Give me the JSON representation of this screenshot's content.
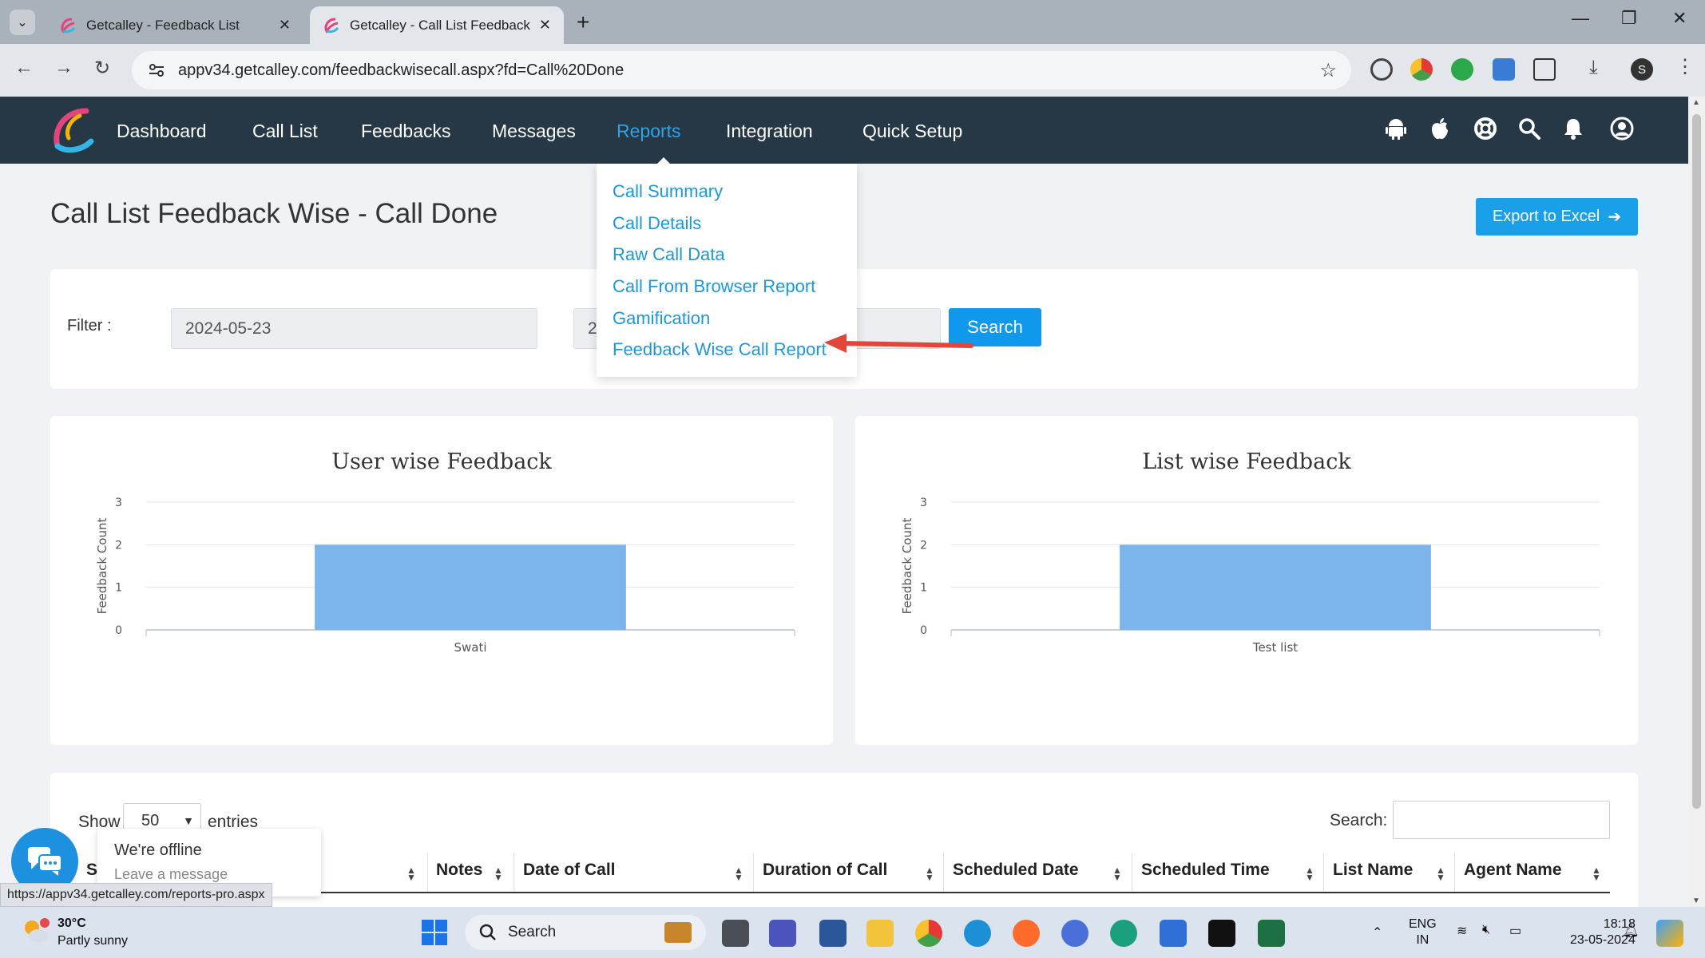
{
  "browser": {
    "tabs": [
      {
        "title": "Getcalley - Feedback List",
        "active": false
      },
      {
        "title": "Getcalley - Call List Feedback Wise",
        "active": true
      }
    ],
    "url": "appv34.getcalley.com/feedbackwisecall.aspx?fd=Call%20Done",
    "status_url": "https://appv34.getcalley.com/reports-pro.aspx"
  },
  "nav": {
    "items": [
      "Dashboard",
      "Call List",
      "Feedbacks",
      "Messages",
      "Reports",
      "Integration",
      "Quick Setup"
    ],
    "active": "Reports"
  },
  "reports_menu": {
    "items": [
      "Call Summary",
      "Call Details",
      "Raw Call Data",
      "Call From Browser Report",
      "Gamification",
      "Feedback Wise Call Report"
    ],
    "highlighted": "Feedback Wise Call Report"
  },
  "page": {
    "title": "Call List Feedback Wise - Call Done",
    "export_label": "Export to Excel",
    "filter_label": "Filter :",
    "from_date": "2024-05-23",
    "to_date_partial": "2",
    "search_label": "Search"
  },
  "chart_data": [
    {
      "type": "bar",
      "title": "User wise Feedback",
      "ylabel": "Feedback Count",
      "categories": [
        "Swati"
      ],
      "values": [
        2
      ],
      "ylim": [
        0,
        3
      ],
      "yticks": [
        "0",
        "1",
        "2",
        "3"
      ],
      "color": "#7cb5ec"
    },
    {
      "type": "bar",
      "title": "List wise Feedback",
      "ylabel": "Feedback Count",
      "categories": [
        "Test list"
      ],
      "values": [
        2
      ],
      "ylim": [
        0,
        3
      ],
      "yticks": [
        "0",
        "1",
        "2",
        "3"
      ],
      "color": "#7cb5ec"
    }
  ],
  "table": {
    "show_label": "Show",
    "entries_value": "50",
    "entries_label": "entries",
    "search_label": "Search:",
    "columns": [
      "S",
      "Notes",
      "Date of Call",
      "Duration of Call",
      "Scheduled Date",
      "Scheduled Time",
      "List Name",
      "Agent Name"
    ]
  },
  "chat": {
    "offline": "We're offline",
    "leave": "Leave a message"
  },
  "taskbar": {
    "temp": "30°C",
    "weather": "Partly sunny",
    "search": "Search",
    "lang1": "ENG",
    "lang2": "IN",
    "time": "18:18",
    "date": "23-05-2024"
  },
  "colors": {
    "nav_bg": "#263746",
    "accent": "#1aa0e8",
    "link": "#1d97d8",
    "bar": "#7cb5ec",
    "arrow": "#e0473a"
  }
}
